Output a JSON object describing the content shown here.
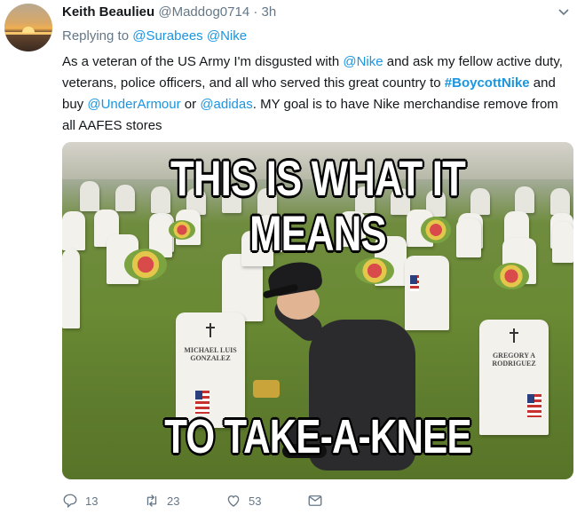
{
  "tweet": {
    "author_name": "Keith Beaulieu",
    "author_handle": "@Maddog0714",
    "separator": "·",
    "time": "3h",
    "replying_prefix": "Replying to",
    "replying_to": [
      "@Surabees",
      "@Nike"
    ],
    "body": {
      "part1": "As a veteran of the US Army I'm disgusted with ",
      "mention1": "@Nike",
      "part2": " and ask my fellow active duty, veterans, police officers, and all who served this great country to ",
      "hashtag": "#BoycottNike",
      "part3": " and buy ",
      "mention2": "@UnderArmour",
      "part4": " or ",
      "mention3": "@adidas",
      "part5": ". MY goal is to have Nike merchandise remove from all AAFES stores"
    },
    "image": {
      "top_text": "THIS IS WHAT IT MEANS",
      "bottom_text": "TO TAKE-A-KNEE",
      "headstone_left": "MICHAEL LUIS\nGONZALEZ",
      "headstone_right": "GREGORY A\nRODRIGUEZ"
    },
    "actions": {
      "reply_count": "13",
      "retweet_count": "23",
      "like_count": "53"
    }
  },
  "colors": {
    "link": "#1b95e0",
    "muted": "#657786",
    "text": "#14171a"
  },
  "icons": [
    "avatar-image",
    "chevron-down-icon",
    "reply-icon",
    "retweet-icon",
    "like-icon",
    "message-icon"
  ]
}
